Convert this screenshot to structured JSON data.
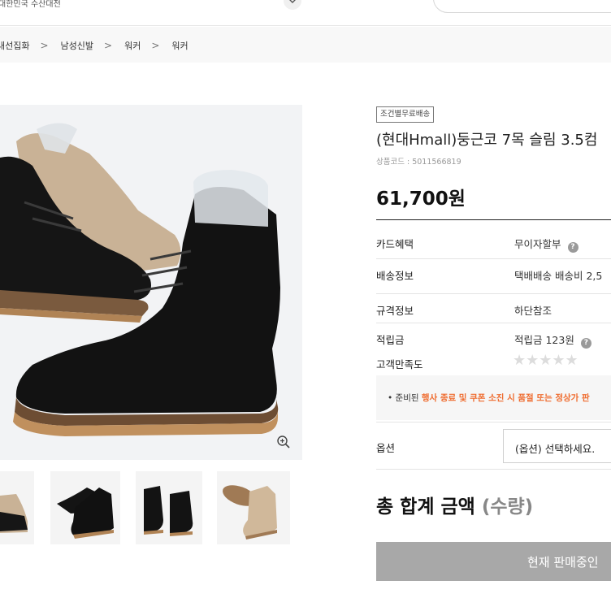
{
  "header": {
    "origin_text": "대한민국 수산대전",
    "search_placeholder": ""
  },
  "breadcrumb": {
    "items": [
      "내선집화",
      "남성신발",
      "워커",
      "워커"
    ],
    "separator": ">"
  },
  "gallery": {
    "main_image": "black-and-beige-suede-lace-up-boots",
    "zoom_icon": "zoom-in-icon",
    "thumbnails": [
      "beige-boot-thumb",
      "black-boots-pair-thumb",
      "black-boots-side-thumb",
      "beige-boot-sole-thumb"
    ]
  },
  "product": {
    "badge": "조건별무료배송",
    "title": "(현대Hmall)둥근코 7목 슬림 3.5컴",
    "code_label": "상품코드 : 5011566819",
    "price": "61,700원"
  },
  "info_rows": {
    "card_label": "카드혜택",
    "card_value": "무이자할부",
    "shipping_label": "배송정보",
    "shipping_value": "택배배송  배송비 2,5",
    "spec_label": "규격정보",
    "spec_value": "하단참조",
    "points_label": "적립금",
    "points_value": "적립금 123원",
    "rating_label": "고객만족도",
    "rating_stars": "★★★★★",
    "rating_value": 0
  },
  "notice": {
    "prefix": "• 준비된 ",
    "highlight": "행사 종료 및 쿠폰 소진 시 품절 또는 정상가 판"
  },
  "option": {
    "label": "옵션",
    "selected": "(옵션) 선택하세요."
  },
  "total": {
    "label": "총 합계 금액 ",
    "qty": "(수량)"
  },
  "buy_button": {
    "label": "현재 판매중인"
  },
  "colors": {
    "accent_orange": "#ef6c2f",
    "disabled_button": "#a8a8a8"
  }
}
